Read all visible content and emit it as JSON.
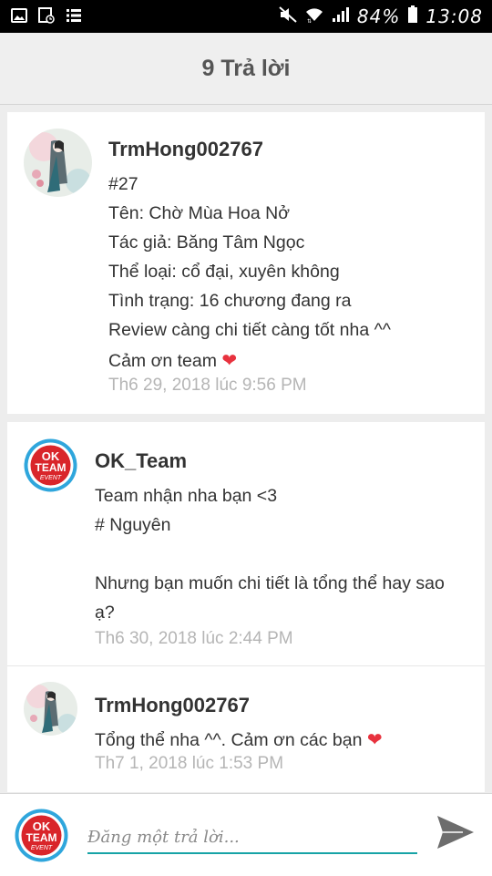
{
  "status_bar": {
    "left_icons": [
      "image-icon",
      "gallery-icon",
      "list-icon"
    ],
    "right_icons": [
      "mute-icon",
      "wifi-icon",
      "signal-icon",
      "battery-icon"
    ],
    "battery": "84%",
    "time": "13:08"
  },
  "header": {
    "title": "9 Trả lời"
  },
  "op": {
    "author": "TrmHong002767",
    "lines": [
      "#27",
      "Tên: Chờ Mùa Hoa Nở",
      "Tác giả: Băng Tâm Ngọc",
      "Thể loại: cổ đại, xuyên không",
      "Tình trạng: 16 chương đang ra",
      "Review càng chi tiết càng tốt nha ^^",
      "Cảm ơn team"
    ],
    "time": "Th6 29, 2018 lúc 9:56 PM"
  },
  "replies": [
    {
      "author": "OK_Team",
      "lines": [
        "Team nhận nha bạn <3",
        "# Nguyên",
        "",
        "Nhưng bạn muốn chi tiết là tổng thể hay sao",
        "ạ?"
      ],
      "time": "Th6 30, 2018 lúc 2:44 PM"
    },
    {
      "author": "TrmHong002767",
      "lines": [
        "Tổng thể nha ^^. Cảm ơn các bạn"
      ],
      "time": "Th7 1, 2018 lúc 1:53 PM"
    }
  ],
  "avatar_badge": {
    "line1": "OK",
    "line2": "TEAM",
    "line3": "EVENT"
  },
  "composer": {
    "placeholder": "Đăng một trả lời..."
  },
  "colors": {
    "accent": "#17a3a6",
    "heart": "#e8323e",
    "timestamp": "#b5b5b5",
    "badge_red": "#d9252a",
    "badge_blue": "#2fa6dc"
  }
}
